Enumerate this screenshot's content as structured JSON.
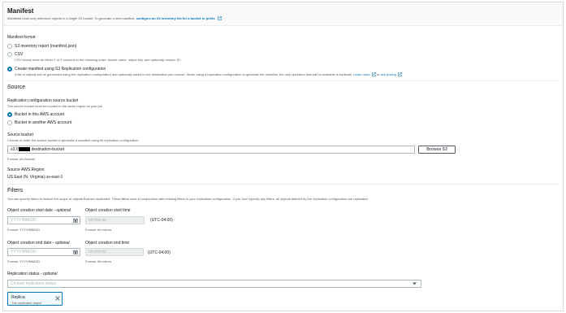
{
  "manifest": {
    "title": "Manifest",
    "description": "Manifests must only reference objects in a single S3 bucket. To generate a new manifest,",
    "link": "configure an S3 inventory list for a bucket or prefix",
    "format_label": "Manifest format",
    "options": [
      {
        "label": "S3 inventory report (manifest.json)",
        "desc": "",
        "selected": false
      },
      {
        "label": "CSV",
        "desc": "CSV format must be either 2 or 3 columns in the following order: bucket name, object key, and optionally version ID.",
        "selected": false
      },
      {
        "label": "Create manifest using S3 Replication configuration",
        "desc": "A list of objects will be generated using the replication configuration and optionally saved to the destination you choose. When using a replication configuration to generate the manifest, the only operation that will be available is replicate.",
        "selected": true
      }
    ],
    "learn_more": "Learn more",
    "or_text": "or",
    "see_pricing": "see pricing"
  },
  "source": {
    "title": "Source",
    "config_label": "Replication configuration source bucket",
    "config_desc": "The source bucket must be located in the same region as your job.",
    "options": [
      {
        "label": "Bucket in this AWS account",
        "selected": true
      },
      {
        "label": "Bucket in another AWS account",
        "selected": false
      }
    ],
    "bucket_label": "Source bucket",
    "bucket_desc": "Choose or enter the source bucket to generate a manifest using its replication configuration.",
    "bucket_prefix": "s3://",
    "bucket_suffix": "destination-bucket",
    "bucket_format": "Format: s3://bucket",
    "browse_label": "Browse S3",
    "region_label": "Source AWS Region",
    "region_value": "US East (N. Virginia) us-east-1"
  },
  "filters": {
    "title": "Filters",
    "description": "You can specify filters to reduce the scope of objects that are replicated. These filters work in conjunction with existing filters in your replication configuration. If you don't specify any filters, all objects defined by the replication configuration are replicated.",
    "start_date_label": "Object creation start date",
    "end_date_label": "Object creation end date",
    "optional": "- optional",
    "date_placeholder": "YYYY/MM/DD",
    "date_format": "Format: YYYY/MM/DD",
    "start_time_label": "Object creation start time",
    "end_time_label": "Object creation end time",
    "time_placeholder": "hh:mm:ss",
    "time_format": "Format: hh:mm:ss",
    "timezone": "(UTC-04:00)",
    "status_label": "Replication status",
    "status_optional": "- optional",
    "status_placeholder": "Choose replication status",
    "token_label": "Replica",
    "token_desc": "The replicated object"
  },
  "colors": {
    "link": "#0073bb",
    "text": "#16191f",
    "muted": "#545b64",
    "border": "#aab7b8"
  },
  "icons": [
    "external-link-icon",
    "calendar-icon",
    "clock-icon",
    "dropdown-caret-icon",
    "close-icon"
  ]
}
